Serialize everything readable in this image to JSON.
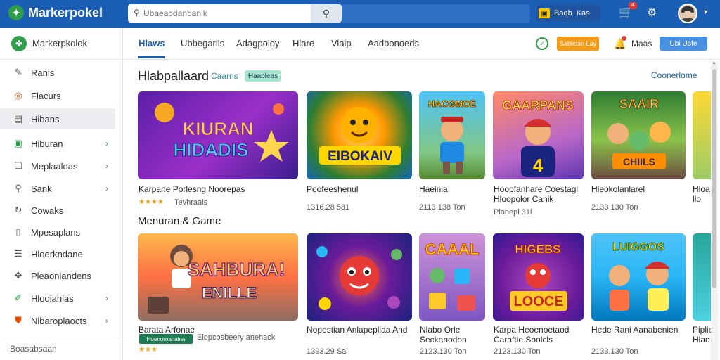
{
  "app": {
    "brand": "Markerpokel"
  },
  "search": {
    "placeholder": "Ubaeaodanbanik"
  },
  "topbar": {
    "promo_label": "Baqb",
    "promo_value": "Kas",
    "cart_badge": "4"
  },
  "sidebar": {
    "header": "Markerpkolok",
    "items": [
      {
        "label": "Ranis",
        "icon": "wrench-icon"
      },
      {
        "label": "Flacurs",
        "icon": "orange-circle-icon"
      },
      {
        "label": "Hibans",
        "icon": "grid-icon",
        "active": true
      },
      {
        "label": "Hiburan",
        "icon": "green-square-icon",
        "chevron": true
      },
      {
        "label": "Meplaaloas",
        "icon": "edit-icon",
        "chevron": true
      },
      {
        "label": "Sank",
        "icon": "search-icon",
        "chevron": true
      },
      {
        "label": "Cowaks",
        "icon": "refresh-icon"
      },
      {
        "label": "Mpesaplans",
        "icon": "document-icon"
      },
      {
        "label": "Hloerkndane",
        "icon": "list-icon"
      },
      {
        "label": "Pleaonlandens",
        "icon": "puzzle-icon"
      },
      {
        "label": "Hlooiahlas",
        "icon": "tool-icon",
        "chevron": true
      },
      {
        "label": "Nlbaroplaocts",
        "icon": "shield-icon",
        "chevron": true
      }
    ],
    "footer": "Boasabsaan"
  },
  "tabs": [
    {
      "label": "Hlaws",
      "active": true
    },
    {
      "label": "Ubbegarils"
    },
    {
      "label": "Adagpoloy"
    },
    {
      "label": "Hlare"
    },
    {
      "label": "Viaip"
    },
    {
      "label": "Aadbonoeds"
    }
  ],
  "toolbar": {
    "orange_button": "Sablelan Lay",
    "bell_label": "Maas",
    "blue_button": "Ubi Ubfe"
  },
  "section1": {
    "title": "Hlabpallaard",
    "subtitle": "Caarns",
    "pill": "Haaoleas",
    "link": "Coonerlome"
  },
  "section2": {
    "title": "Menuran & Game"
  },
  "row1": [
    {
      "art_text": "KIURAN HIDADIS",
      "title": "Karpane Porlesng Noorepas",
      "meta": "Tevhraais",
      "rating": "★★★★"
    },
    {
      "art_text": "EIBOKAIV",
      "title": "Poofeeshenul",
      "meta": "1316.28 581"
    },
    {
      "art_text": "HACGMOE",
      "title": "Haeinia",
      "meta": "2113 138 Ton"
    },
    {
      "art_text": "GAARPANS",
      "title": "Hoopfanhare Coestagl Hloopolor Canik",
      "meta": "Plonepl 31l"
    },
    {
      "art_text": "SAAIR CHIILS",
      "title": "Hleokolanlarel",
      "meta": "2133 130 Ton"
    },
    {
      "art_text": "",
      "title": "Hloa llo",
      "meta": ""
    }
  ],
  "row2": [
    {
      "art_text": "SAHBURA! ENILLE",
      "title": "Barata Arfonae",
      "meta": "Elopcosbeery anehack",
      "pill": "Hoenoroanalna",
      "rating": "★★★"
    },
    {
      "art_text": "",
      "title": "Nopestian Anlapepliaa And",
      "meta": "1393.29 Sal"
    },
    {
      "art_text": "CAAAL",
      "title": "Nlabo Orle Seckanodon",
      "meta": "2123.130 Ton"
    },
    {
      "art_text": "HIGEBS LOOCE",
      "title": "Karpa Heoenoetaod Caraftie Soolcls",
      "meta": "2123.130 Ton"
    },
    {
      "art_text": "LUIGGOS",
      "title": "Hede Rani Aanabenien",
      "meta": "2133.130 Ton"
    },
    {
      "art_text": "",
      "title": "Piplie Hlao",
      "meta": ""
    }
  ]
}
